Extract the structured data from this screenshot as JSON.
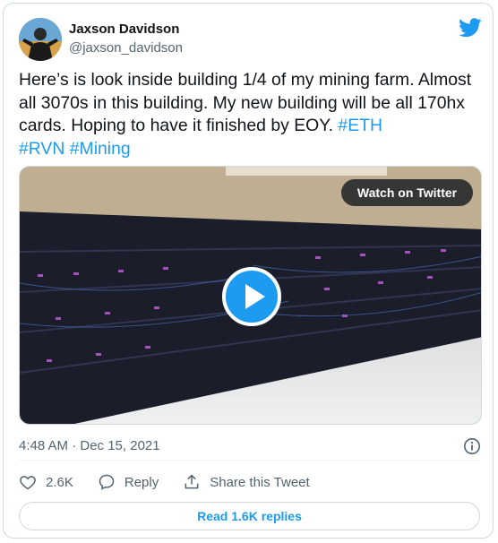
{
  "author": {
    "name": "Jaxson Davidson",
    "handle": "@jaxson_davidson",
    "avatar_icon": "avatar-icon"
  },
  "tweet": {
    "text_main": "Here’s is look inside building 1/4 of my mining farm. Almost all 3070s in this building. My new building will be all 170hx cards. Hoping to have it finished by EOY.",
    "hashtags": [
      "#ETH",
      "#RVN",
      "#Mining"
    ]
  },
  "media": {
    "watch_label": "Watch on Twitter"
  },
  "timestamp": "4:48 AM · Dec 15, 2021",
  "actions": {
    "likes": "2.6K",
    "reply_label": "Reply",
    "share_label": "Share this Tweet"
  },
  "replies_button": "Read 1.6K replies",
  "colors": {
    "accent": "#1d9bf0",
    "muted": "#536471",
    "text": "#0f1419",
    "border": "#cfd9de"
  }
}
